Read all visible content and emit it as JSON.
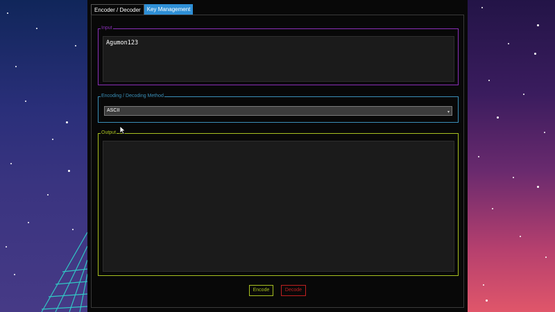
{
  "tabs": [
    {
      "label": "Encoder / Decoder",
      "active": true
    },
    {
      "label": "Key Management",
      "active": false
    }
  ],
  "input_group": {
    "legend": "Input",
    "value": "Agumon123",
    "border_color": "#8a2fb8"
  },
  "method_group": {
    "legend": "Encoding / Decoding Method",
    "selected": "ASCII",
    "border_color": "#3a8fb8"
  },
  "output_group": {
    "legend": "Output",
    "value": "",
    "border_color": "#a8c020"
  },
  "buttons": {
    "encode": {
      "label": "Encode",
      "color": "#a8c020"
    },
    "decode": {
      "label": "Decode",
      "color": "#c02020"
    }
  },
  "colors": {
    "tab_inactive": "#2e8fd6",
    "window_bg": "#080808",
    "textbox_bg": "#1b1b1b"
  }
}
